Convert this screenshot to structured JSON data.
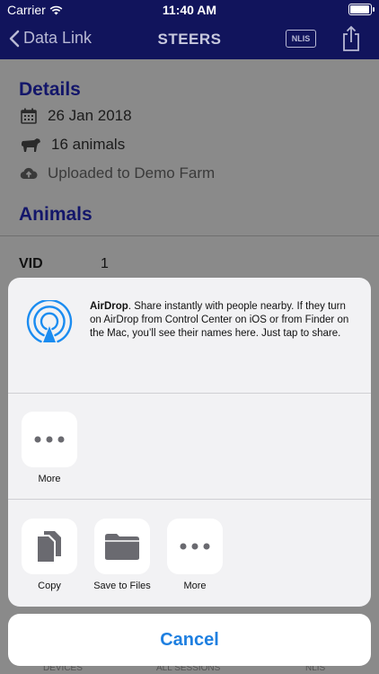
{
  "status": {
    "carrier": "Carrier",
    "time": "11:40 AM",
    "battery_level": 0.95
  },
  "navbar": {
    "back_label": "Data Link",
    "title": "STEERS",
    "nlis_label": "NLIS"
  },
  "details": {
    "heading": "Details",
    "date": "26 Jan 2018",
    "animals_count": "16 animals",
    "upload_status": "Uploaded to Demo Farm"
  },
  "animals": {
    "heading": "Animals",
    "vid_label": "VID",
    "vid_value": "1"
  },
  "tabbar": {
    "devices": "DEVICES",
    "all_sessions": "ALL SESSIONS",
    "nlis": "NLIS"
  },
  "share_sheet": {
    "airdrop_title": "AirDrop",
    "airdrop_text": ". Share instantly with people nearby. If they turn on AirDrop from Control Center on iOS or from Finder on the Mac, you’ll see their names here. Just tap to share.",
    "row1": [
      {
        "label": "More",
        "icon": "more-icon"
      }
    ],
    "row2": [
      {
        "label": "Copy",
        "icon": "copy-icon"
      },
      {
        "label": "Save to Files",
        "icon": "folder-icon"
      },
      {
        "label": "More",
        "icon": "more-icon"
      }
    ],
    "cancel_label": "Cancel"
  },
  "colors": {
    "nav_bg": "#11145c",
    "heading": "#13166a",
    "accent": "#1e7fe0",
    "airdrop_blue": "#1b8cf0"
  }
}
